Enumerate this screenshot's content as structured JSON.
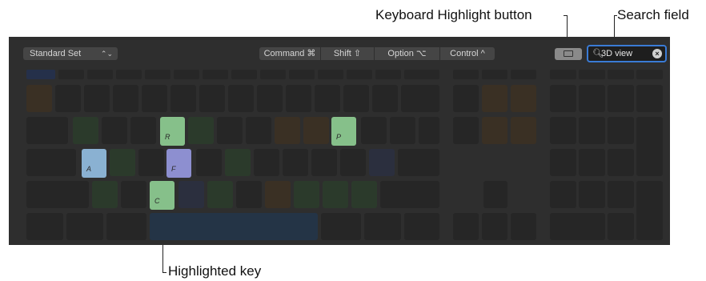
{
  "callouts": {
    "keyboard_highlight": "Keyboard Highlight button",
    "search_field": "Search field",
    "highlighted_key": "Highlighted key"
  },
  "toolbar": {
    "command_set": "Standard Set",
    "modifiers": [
      "Command ⌘",
      "Shift ⇧",
      "Option ⌥",
      "Control ^"
    ]
  },
  "search": {
    "value": "3D view"
  },
  "highlighted_keys": [
    {
      "label": "R",
      "color": "#86c08a"
    },
    {
      "label": "P",
      "color": "#86c08a"
    },
    {
      "label": "A",
      "color": "#8ab1d2"
    },
    {
      "label": "F",
      "color": "#8d8fd0"
    },
    {
      "label": "C",
      "color": "#86c08a"
    }
  ]
}
